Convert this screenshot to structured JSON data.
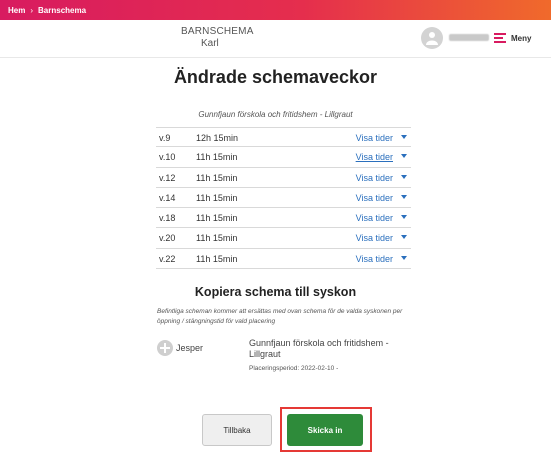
{
  "breadcrumb": {
    "home": "Hem",
    "separator": "›",
    "current": "Barnschema"
  },
  "header": {
    "app_title": "BARNSCHEMA",
    "child_name": "Karl",
    "menu_label": "Meny",
    "avatar_icon": "person-icon",
    "menu_icon": "hamburger-menu-icon"
  },
  "main": {
    "title": "Ändrade schemaveckor",
    "school": "Gunnfjaun förskola och fritidshem - Lillgraut",
    "weeks": [
      {
        "week": "v.9",
        "time": "12h 15min",
        "link": "Visa tider"
      },
      {
        "week": "v.10",
        "time": "11h 15min",
        "link": "Visa tider"
      },
      {
        "week": "v.12",
        "time": "11h 15min",
        "link": "Visa tider"
      },
      {
        "week": "v.14",
        "time": "11h 15min",
        "link": "Visa tider"
      },
      {
        "week": "v.18",
        "time": "11h 15min",
        "link": "Visa tider"
      },
      {
        "week": "v.20",
        "time": "11h 15min",
        "link": "Visa tider"
      },
      {
        "week": "v.22",
        "time": "11h 15min",
        "link": "Visa tider"
      }
    ]
  },
  "copy": {
    "title": "Kopiera schema till syskon",
    "description": "Befintliga scheman kommer att ersättas med ovan schema för de valda syskonen per öppning / stängningstid för vald placering",
    "sibling": {
      "name": "Jesper",
      "school": "Gunnfjaun förskola och fritidshem - Lillgraut",
      "period": "Placeringsperiod: 2022-02-10 -"
    }
  },
  "actions": {
    "back_label": "Tillbaka",
    "submit_label": "Skicka in",
    "highlight_color": "#e53935",
    "submit_color": "#2e8b3a"
  }
}
